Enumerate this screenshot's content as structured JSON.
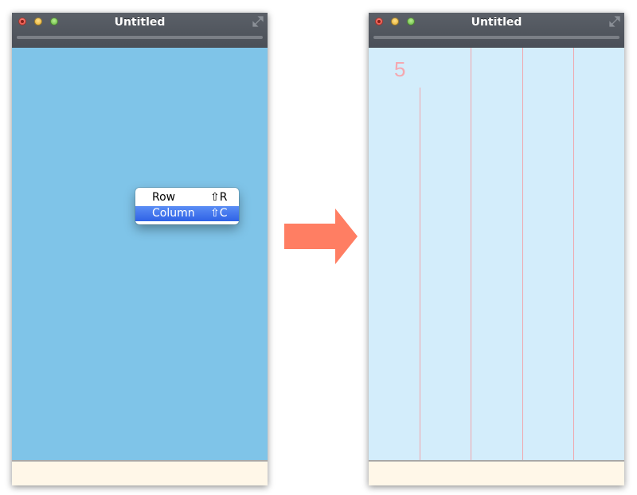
{
  "before_window": {
    "title": "Untitled",
    "popup_menu": {
      "items": [
        {
          "label": "Row",
          "shortcut": "⇧R",
          "selected": false
        },
        {
          "label": "Column",
          "shortcut": "⇧C",
          "selected": true
        }
      ]
    }
  },
  "after_window": {
    "title": "Untitled",
    "column_count": "5"
  },
  "colors": {
    "titlebar": "#4f545c",
    "canvas_before": "#7fc4e8",
    "canvas_after": "#d3edfb",
    "column_guide": "#f0a6ac",
    "menu_highlight": "#3a6df0",
    "status_bar": "#fff7e8",
    "arrow": "#ff7e63"
  },
  "icons": {
    "transition_arrow": "right-arrow-icon",
    "fullscreen": "fullscreen-arrows-icon"
  }
}
